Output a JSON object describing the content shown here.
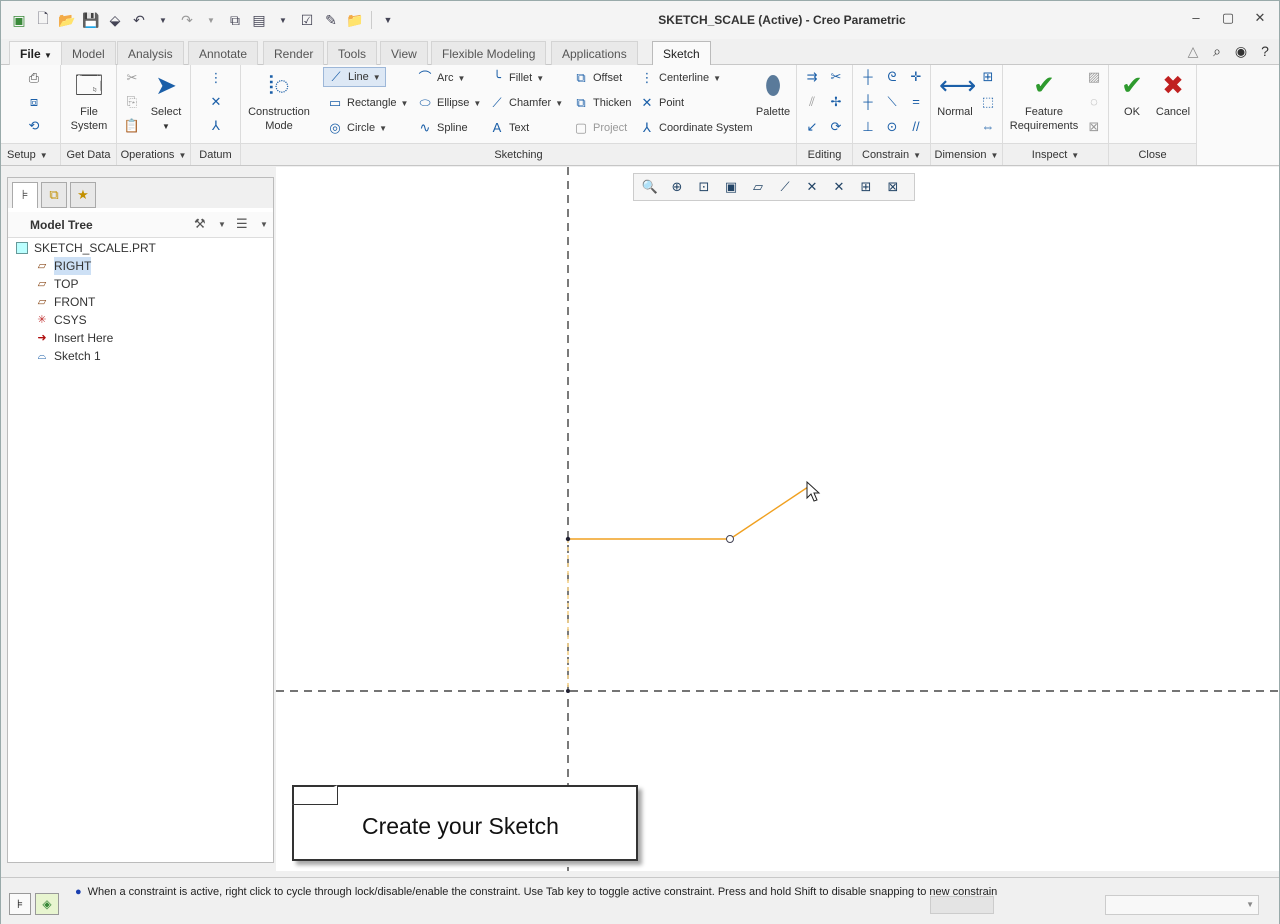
{
  "window": {
    "title": "SKETCH_SCALE (Active) - Creo Parametric"
  },
  "tabs": [
    "File",
    "Model",
    "Analysis",
    "Annotate",
    "Render",
    "Tools",
    "View",
    "Flexible Modeling",
    "Applications",
    "Sketch"
  ],
  "ribbon": {
    "setup": {
      "label": "Setup"
    },
    "get_data": {
      "label": "Get Data",
      "file_system": "File System"
    },
    "operations": {
      "label": "Operations",
      "select": "Select"
    },
    "datum": {
      "label": "Datum"
    },
    "sketching": {
      "label": "Sketching",
      "construction_mode": "Construction Mode",
      "line": "Line",
      "rectangle": "Rectangle",
      "circle": "Circle",
      "arc": "Arc",
      "ellipse": "Ellipse",
      "spline": "Spline",
      "fillet": "Fillet",
      "chamfer": "Chamfer",
      "text": "Text",
      "offset": "Offset",
      "thicken": "Thicken",
      "project": "Project",
      "centerline": "Centerline",
      "point": "Point",
      "coordinate_system": "Coordinate System",
      "palette": "Palette"
    },
    "editing": {
      "label": "Editing"
    },
    "constrain": {
      "label": "Constrain"
    },
    "dimension": {
      "label": "Dimension",
      "normal": "Normal"
    },
    "inspect": {
      "label": "Inspect",
      "feature_requirements": "Feature Requirements"
    },
    "close": {
      "label": "Close",
      "ok": "OK",
      "cancel": "Cancel"
    }
  },
  "model_tree": {
    "header": "Model Tree",
    "root": "SKETCH_SCALE.PRT",
    "items": [
      "RIGHT",
      "TOP",
      "FRONT",
      "CSYS",
      "Insert Here",
      "Sketch 1"
    ]
  },
  "canvas": {
    "callout": "Create your Sketch"
  },
  "status": {
    "message": "When a constraint is active, right click to cycle through lock/disable/enable the constraint. Use Tab key to toggle active constraint. Press and hold Shift to disable snapping to new constraints."
  },
  "colors": {
    "sketch_line": "#f0a020",
    "accent": "#1b5fa8",
    "ok": "#2e9a2e",
    "cancel": "#c02020"
  }
}
